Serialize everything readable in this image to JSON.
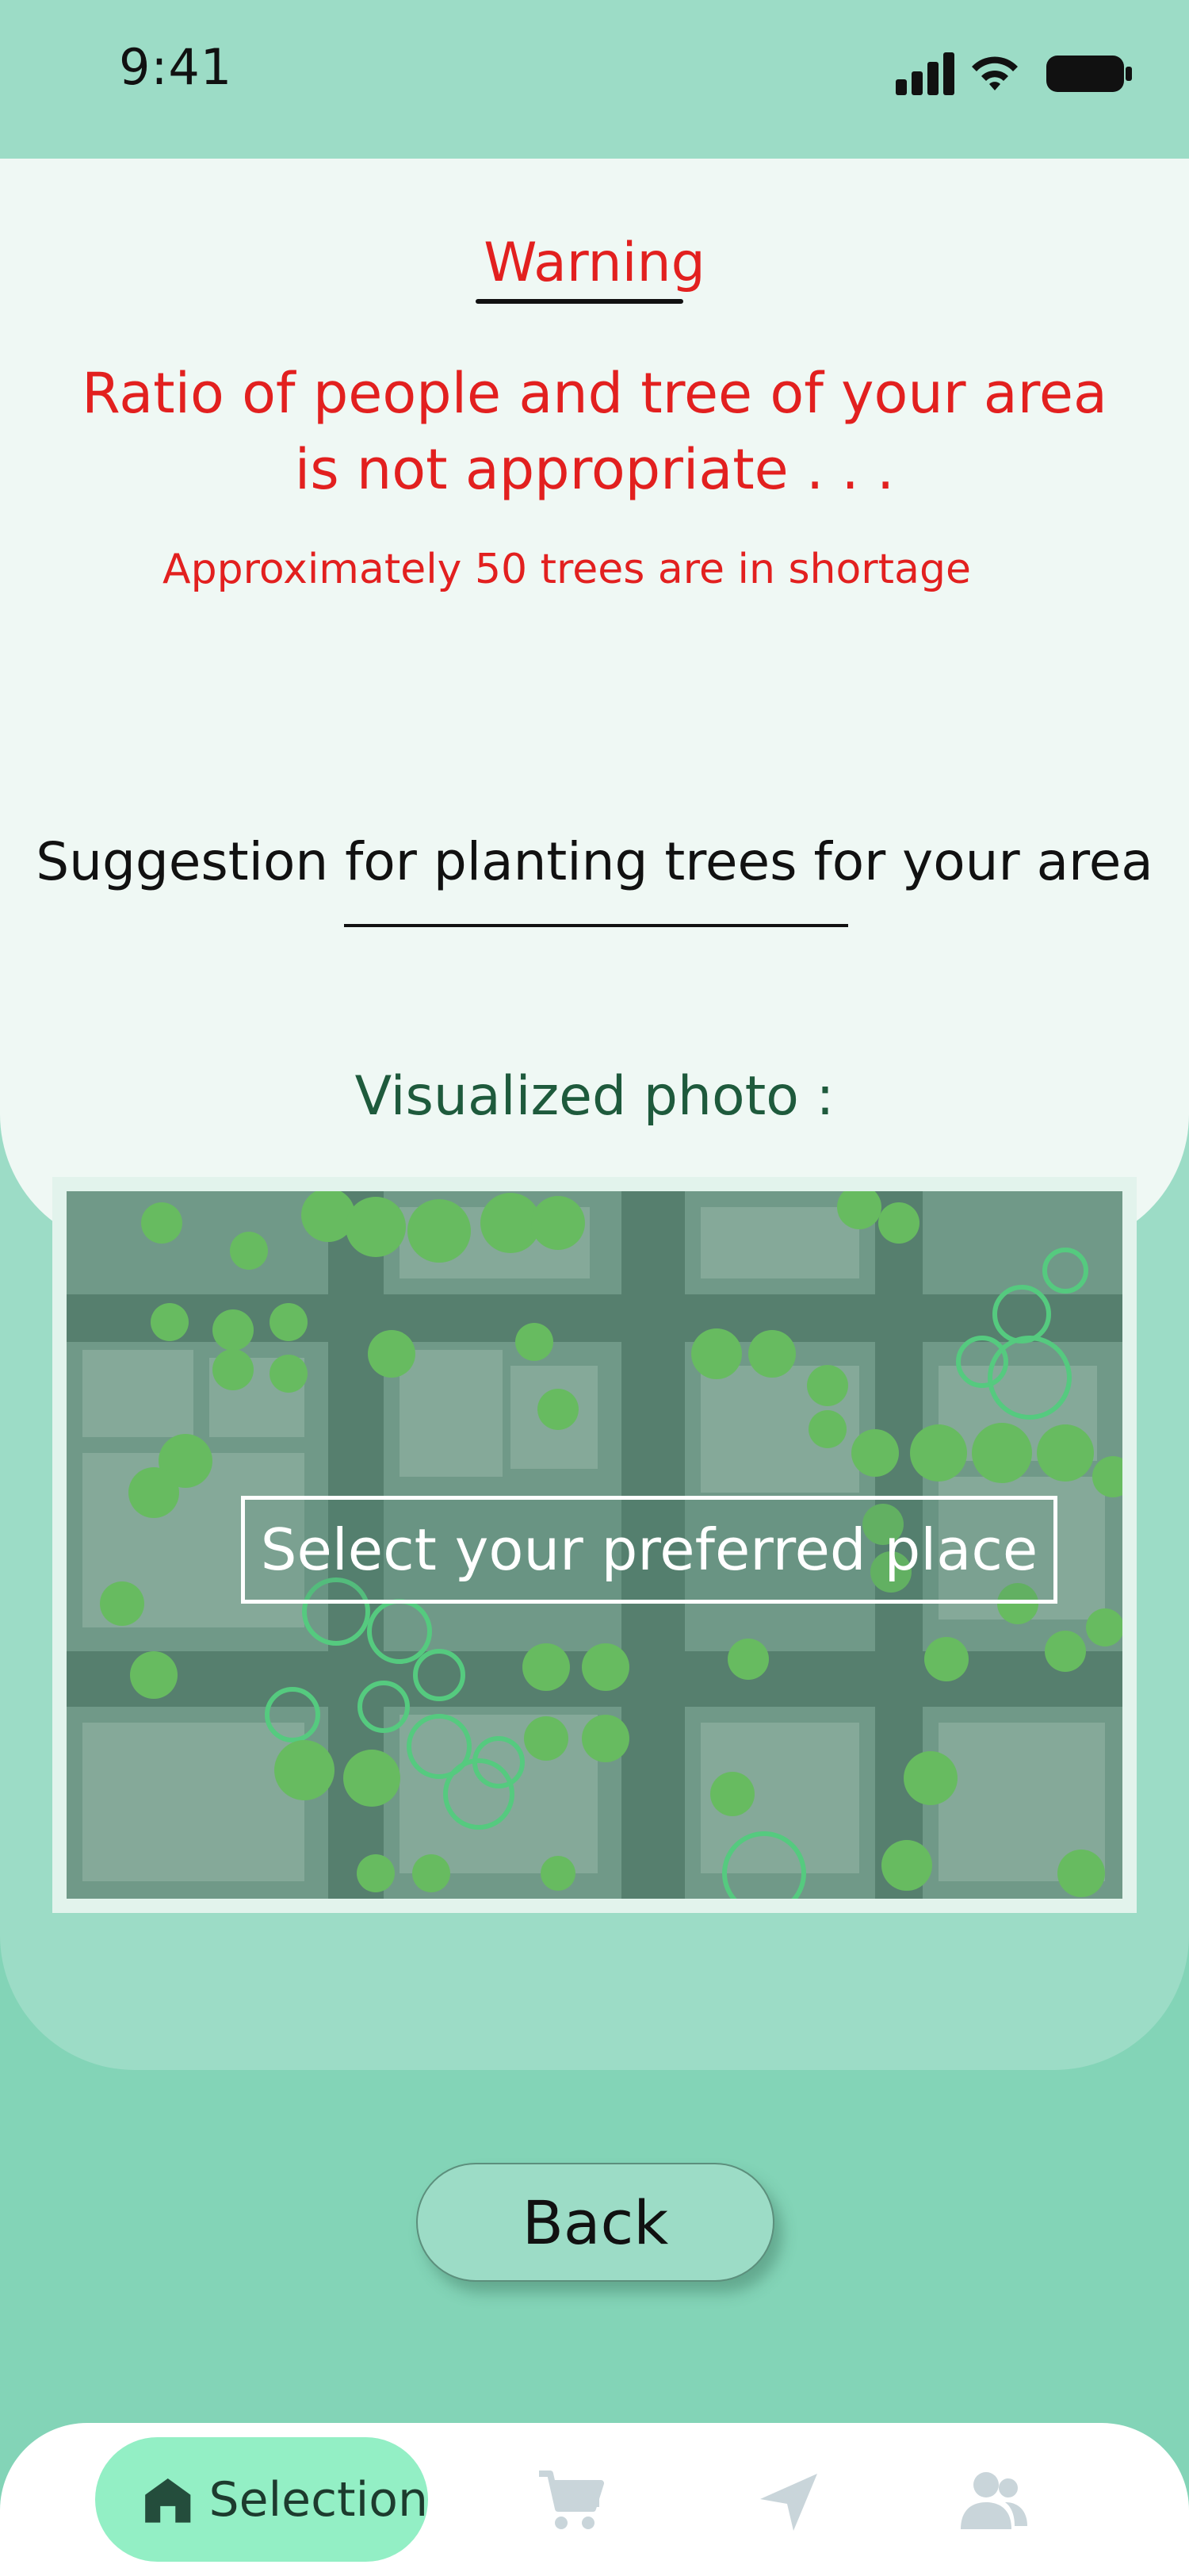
{
  "status_bar": {
    "time": "9:41"
  },
  "warning": {
    "title": "Warning",
    "message": "Ratio of people and tree of your area is not appropriate . . .",
    "shortage": "Approximately 50 trees are in shortage"
  },
  "suggestion": {
    "heading": "Suggestion for planting trees for your area"
  },
  "visualized": {
    "label": "Visualized photo :",
    "select_prompt": "Select your preferred place"
  },
  "back_label": "Back",
  "nav": {
    "items": [
      {
        "label": "Selection",
        "icon": "home-icon",
        "active": true
      },
      {
        "label": "",
        "icon": "cart-icon",
        "active": false
      },
      {
        "label": "",
        "icon": "navigation-arrow-icon",
        "active": false
      },
      {
        "label": "",
        "icon": "users-icon",
        "active": false
      }
    ]
  },
  "colors": {
    "warning_red": "#e2201f",
    "nav_active": "#93efc5",
    "background": "#83d4b7",
    "card": "#eff8f4"
  }
}
